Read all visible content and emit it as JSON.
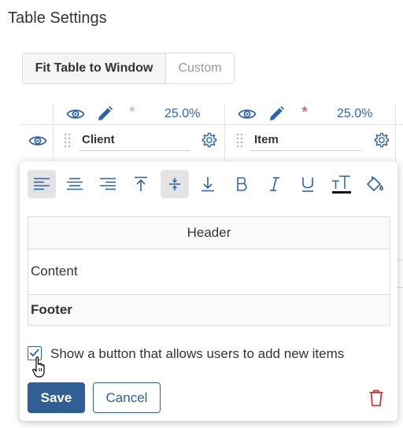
{
  "page": {
    "title": "Table Settings"
  },
  "mode_switch": {
    "fit_label": "Fit Table to Window",
    "custom_label": "Custom",
    "selected": "fit"
  },
  "columns": [
    {
      "name": "Client",
      "width_percent": "25.0%",
      "required": false
    },
    {
      "name": "Item",
      "width_percent": "25.0%",
      "required": true
    }
  ],
  "colors": {
    "accent": "#2d64a8",
    "required_star": "#e03b3b",
    "optional_star": "#b5b5b5",
    "delete": "#d32f2f"
  },
  "toolbar": {
    "buttons": [
      {
        "icon": "align-left-icon",
        "active": true
      },
      {
        "icon": "align-center-icon",
        "active": false
      },
      {
        "icon": "align-right-icon",
        "active": false
      },
      {
        "icon": "align-top-icon",
        "active": false
      },
      {
        "icon": "align-middle-icon",
        "active": true
      },
      {
        "icon": "align-bottom-icon",
        "active": false
      },
      {
        "icon": "bold-icon",
        "active": false
      },
      {
        "icon": "italic-icon",
        "active": false
      },
      {
        "icon": "underline-icon",
        "active": false
      },
      {
        "icon": "text-color-icon",
        "active": false
      },
      {
        "icon": "fill-color-icon",
        "active": false
      }
    ]
  },
  "preview": {
    "header": "Header",
    "content": "Content",
    "footer": "Footer"
  },
  "add_items": {
    "label": "Show a button that allows users to add new items",
    "checked": true
  },
  "actions": {
    "save": "Save",
    "cancel": "Cancel"
  }
}
